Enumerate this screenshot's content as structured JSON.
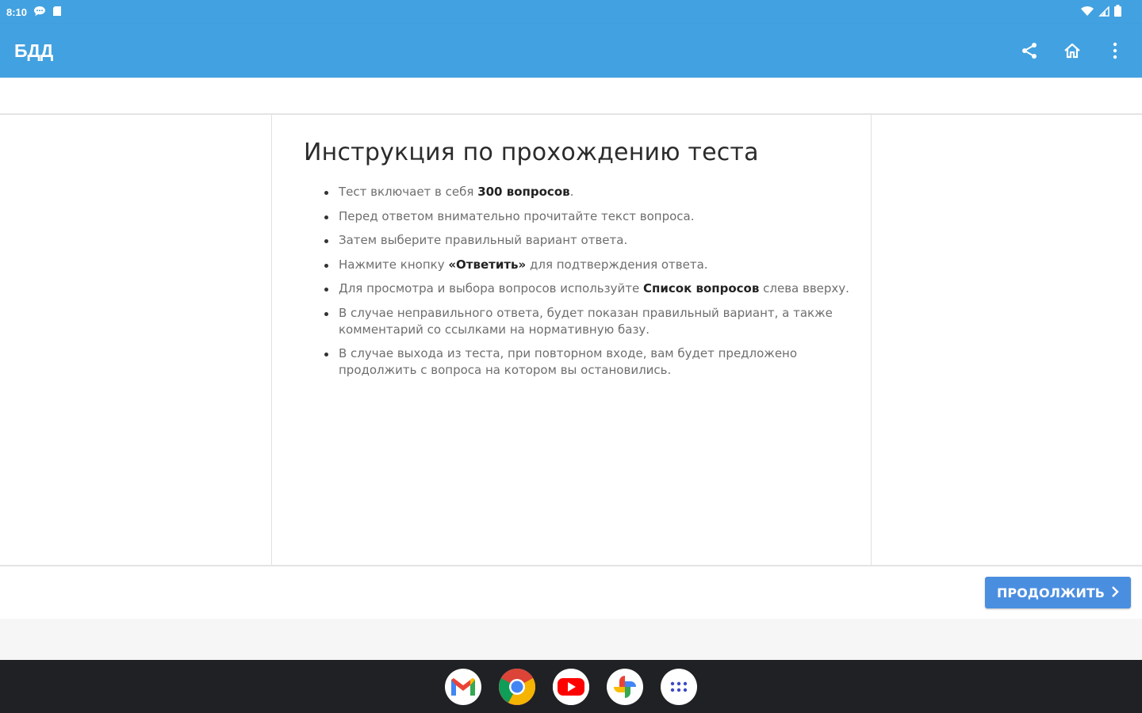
{
  "status_bar": {
    "time": "8:10",
    "left_icons": [
      "chat-bubble-icon",
      "sd-card-icon"
    ],
    "right_icons": [
      "wifi-icon",
      "signal-icon",
      "battery-icon"
    ]
  },
  "app_bar": {
    "title": "БДД",
    "actions": [
      "share-icon",
      "home-icon",
      "more-vert-icon"
    ],
    "color": "#42a1e0"
  },
  "instructions": {
    "title": "Инструкция по прохождению теста",
    "items": [
      {
        "pre": "Тест включает в себя ",
        "bold": "300 вопросов",
        "post": "."
      },
      {
        "pre": "Перед ответом внимательно прочитайте текст вопроса.",
        "bold": "",
        "post": ""
      },
      {
        "pre": "Затем выберите правильный вариант ответа.",
        "bold": "",
        "post": ""
      },
      {
        "pre": "Нажмите кнопку ",
        "bold": "«Ответить»",
        "post": " для подтверждения ответа."
      },
      {
        "pre": "Для просмотра и выбора вопросов используйте ",
        "bold": "Список вопросов",
        "post": " слева вверху."
      },
      {
        "pre": "В случае неправильного ответа, будет показан правильный вариант, а также комментарий со ссылками на нормативную базу.",
        "bold": "",
        "post": ""
      },
      {
        "pre": "В случае выхода из теста, при повторном входе, вам будет предложено продолжить с вопроса на котором вы остановились.",
        "bold": "",
        "post": ""
      }
    ]
  },
  "footer": {
    "continue_label": "ПРОДОЛЖИТЬ",
    "button_color": "#4a8ee0"
  },
  "taskbar": {
    "apps": [
      "gmail-icon",
      "chrome-icon",
      "youtube-icon",
      "photos-icon",
      "app-launcher-icon"
    ]
  }
}
